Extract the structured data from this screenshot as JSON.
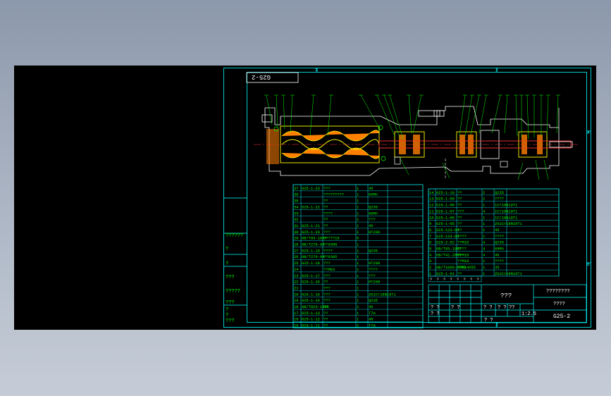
{
  "colors": {
    "background": "#000000",
    "frame": "#00ffff",
    "table_text": "#00ff00",
    "table_lines": "#00ffff",
    "title_text": "#ffffff",
    "part_outline": "#ffff00",
    "part_fill": "#ff8000",
    "shaft": "#ff3030",
    "section_lines": "#00ff00",
    "page_gradient_top": "#8c98ab",
    "page_gradient_bottom": "#c5ccd7"
  },
  "drawing": {
    "code_box": "G25-2",
    "section_markers": {
      "top": [
        "1",
        "2"
      ],
      "right": [
        "A",
        "B"
      ],
      "bottom": [
        "2"
      ]
    },
    "left_panel": [
      "??????",
      "?",
      "?",
      "???",
      "?????",
      "???",
      "?",
      "?",
      "???"
    ]
  },
  "bom": {
    "left": [
      {
        "no": "37",
        "code": "G25-1-23",
        "name": "???",
        "qty": "1",
        "mat": "45"
      },
      {
        "no": "36",
        "code": "",
        "name": "?????????",
        "qty": "1",
        "mat": "65Mn"
      },
      {
        "no": "35",
        "code": "",
        "name": "??",
        "qty": "1",
        "mat": ""
      },
      {
        "no": "34",
        "code": "G25-1-22",
        "name": "??",
        "qty": "1",
        "mat": "Q235"
      },
      {
        "no": "33",
        "code": "",
        "name": "????",
        "qty": "1",
        "mat": "65Mn"
      },
      {
        "no": "32",
        "code": "",
        "name": "??",
        "qty": "1",
        "mat": "???"
      },
      {
        "no": "31",
        "code": "G25-1-21",
        "name": "??",
        "qty": "1",
        "mat": "45"
      },
      {
        "no": "30",
        "code": "G25-1-20",
        "name": "???",
        "qty": "1",
        "mat": "HT200"
      },
      {
        "no": "29",
        "code": "GB/T93-1987",
        "name": "?????16",
        "qty": "6",
        "mat": ""
      },
      {
        "no": "28",
        "code": "GB/T276-94",
        "name": "??6305",
        "qty": "1",
        "mat": ""
      },
      {
        "no": "27",
        "code": "G25-1-19",
        "name": "????",
        "qty": "1",
        "mat": "Q235"
      },
      {
        "no": "26",
        "code": "GB/T276-94",
        "name": "??6305",
        "qty": "1",
        "mat": ""
      },
      {
        "no": "25",
        "code": "G25-1-18",
        "name": "???",
        "qty": "1",
        "mat": "HT200"
      },
      {
        "no": "24",
        "code": "",
        "name": "??M63",
        "qty": "1",
        "mat": "????"
      },
      {
        "no": "23",
        "code": "G25-1-17",
        "name": "???",
        "qty": "1",
        "mat": "???"
      },
      {
        "no": "22",
        "code": "G25-1-16",
        "name": "??",
        "qty": "1",
        "mat": "HT200"
      },
      {
        "no": "21",
        "code": "",
        "name": "???",
        "qty": "1",
        "mat": ""
      },
      {
        "no": "20",
        "code": "G25-1-15",
        "name": "???",
        "qty": "1",
        "mat": "ZG1Cr18Ni9Ti"
      },
      {
        "no": "19",
        "code": "G25-1-14",
        "name": "???",
        "qty": "1",
        "mat": "Q235"
      },
      {
        "no": "18",
        "code": "GB/T823-1988",
        "name": "??",
        "qty": "2",
        "mat": "45"
      },
      {
        "no": "17",
        "code": "G25-1-13",
        "name": "??",
        "qty": "1",
        "mat": "T7A"
      },
      {
        "no": "16",
        "code": "G25-1-12",
        "name": "??",
        "qty": "1",
        "mat": "45"
      },
      {
        "no": "15",
        "code": "G25-1-11",
        "name": "??",
        "qty": "2",
        "mat": "T7A"
      }
    ],
    "right": [
      {
        "no": "14",
        "code": "G25-1-10",
        "name": "??",
        "qty": "2",
        "mat": "Q235"
      },
      {
        "no": "13",
        "code": "G25-1-09",
        "name": "??",
        "qty": "2",
        "mat": "????"
      },
      {
        "no": "12",
        "code": "G25-1-08",
        "name": "??",
        "qty": "1",
        "mat": "1Cr18Ni9Ti"
      },
      {
        "no": "11",
        "code": "G25-1-07",
        "name": "???",
        "qty": "4",
        "mat": "1Cr18Ni9Ti"
      },
      {
        "no": "10",
        "code": "G25-1-06",
        "name": "??",
        "qty": "1",
        "mat": "1Cr18Ni9Ti"
      },
      {
        "no": "9",
        "code": "G25-1-05",
        "name": "??",
        "qty": "1",
        "mat": "ZG1Cr18Ni9Ti"
      },
      {
        "no": "8",
        "code": "G25-123-04",
        "name": "??",
        "qty": "1",
        "mat": "45"
      },
      {
        "no": "7",
        "code": "G25-123-03",
        "name": "????",
        "qty": "1",
        "mat": "????"
      },
      {
        "no": "6",
        "code": "G25-2-02",
        "name": "??M10",
        "qty": "4",
        "mat": "Q235"
      },
      {
        "no": "5",
        "code": "GB/T93-1987",
        "name": "????",
        "qty": "4",
        "mat": "65Mn"
      },
      {
        "no": "4",
        "code": "GB/T41-2000",
        "name": "??M10",
        "qty": "4",
        "mat": "45"
      },
      {
        "no": "3",
        "code": "",
        "name": "??M10",
        "qty": "1",
        "mat": "????"
      },
      {
        "no": "2",
        "code": "GB/T1096-2003",
        "name": "??M14X55",
        "qty": "1",
        "mat": "35"
      },
      {
        "no": "1",
        "code": "G25-1-01",
        "name": "??",
        "qty": "1",
        "mat": "ZG1Cr18Ni9Ti"
      }
    ],
    "header_marks": [
      "?",
      "?",
      "?",
      "?",
      "?",
      "?",
      "?",
      "?"
    ]
  },
  "title_block": {
    "name": "???",
    "company": "????????",
    "sub": "????",
    "drawing_no": "G25-2",
    "scale_label": "??",
    "scale": "1:2.5",
    "sheet": "? ?",
    "marks": [
      "? ?",
      "? ?",
      "? ?",
      "? ?",
      "? ?"
    ]
  }
}
